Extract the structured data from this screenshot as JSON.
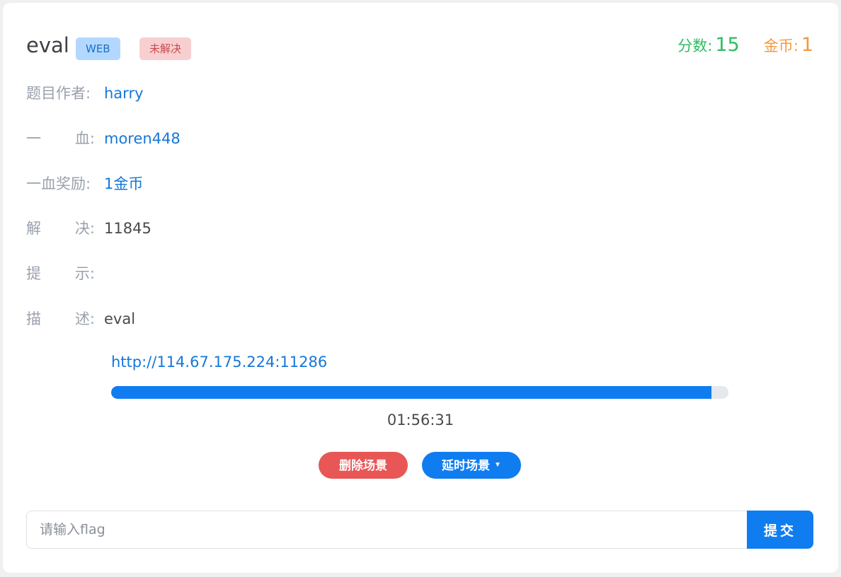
{
  "header": {
    "title": "eval",
    "category_badge": "WEB",
    "status_badge": "未解决",
    "score_label": "分数:",
    "score_value": "15",
    "coin_label": "金币:",
    "coin_value": "1"
  },
  "details": {
    "author": {
      "label_left": "题目作者:",
      "value": "harry"
    },
    "first_blood": {
      "label_a": "一",
      "label_b": "血:",
      "value": "moren448"
    },
    "first_blood_reward": {
      "label_left": "一血奖励:",
      "value": "1金币"
    },
    "solved": {
      "label_a": "解",
      "label_b": "决:",
      "value": "11845"
    },
    "hint": {
      "label_a": "提",
      "label_b": "示:",
      "value": ""
    },
    "description": {
      "label_a": "描",
      "label_b": "述:",
      "value": "eval"
    }
  },
  "scene": {
    "url": "http://114.67.175.224:11286",
    "progress": 0.972,
    "timer": "01:56:31",
    "delete_button": "删除场景",
    "delay_button": "延时场景"
  },
  "flag": {
    "placeholder": "请输入flag",
    "value": "",
    "submit_label": "提交"
  },
  "colors": {
    "primary": "#0f7df0",
    "danger": "#e85656",
    "score_green": "#2ebd60",
    "coin_orange": "#f59a3a"
  }
}
